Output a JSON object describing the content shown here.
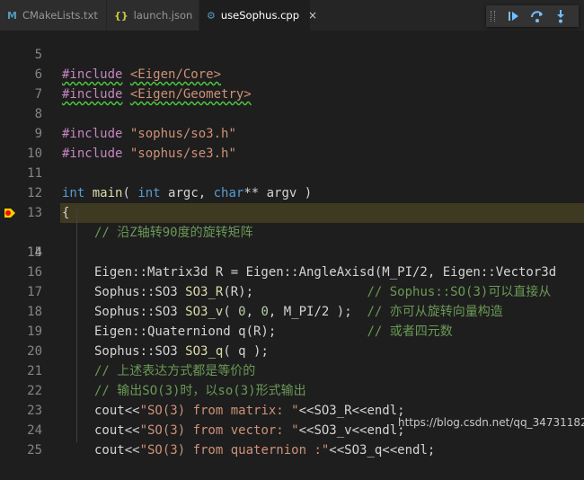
{
  "tabs": [
    {
      "icon": "M",
      "label": "CMakeLists.txt",
      "icon_color": "#519aba"
    },
    {
      "icon": "{}",
      "label": "launch.json",
      "icon_color": "#cbcb41"
    },
    {
      "icon": "⚙",
      "label": "useSophus.cpp",
      "icon_color": "#519aba",
      "active": true,
      "close": "×"
    }
  ],
  "debug_toolbar": {
    "buttons": [
      "continue-icon",
      "step-over-icon",
      "step-into-icon"
    ]
  },
  "editor": {
    "current_line": "14",
    "lines": [
      {
        "n": "5"
      },
      {
        "n": "6"
      },
      {
        "n": "7"
      },
      {
        "n": "8"
      },
      {
        "n": "9"
      },
      {
        "n": "10"
      },
      {
        "n": "11"
      },
      {
        "n": "12"
      },
      {
        "n": "13"
      },
      {
        "n": "14"
      },
      {
        "n": "15"
      },
      {
        "n": "16"
      },
      {
        "n": "17"
      },
      {
        "n": "18"
      },
      {
        "n": "19"
      },
      {
        "n": "20"
      },
      {
        "n": "21"
      },
      {
        "n": "22"
      },
      {
        "n": "23"
      },
      {
        "n": "24"
      },
      {
        "n": "25"
      }
    ],
    "t": {
      "inc": "#include",
      "l5": "<Eigen/Core>",
      "l6": "<Eigen/Geometry>",
      "l8": "\"sophus/so3.h\"",
      "l9": "\"sophus/se3.h\"",
      "int": "int",
      "main": "main",
      "char": "char",
      "l11a": "( ",
      "l11b": " argc, ",
      "l11c": "** argv )",
      "l12": "{",
      "l13": "// 沿Z轴转90度的旋转矩阵",
      "l14a": "Eigen::Matrix3d R = Eigen::AngleAxisd(M_PI/2, Eigen::Vector3d",
      "so3": "Sophus::SO3 ",
      "so3r": "SO3_R",
      "l16b": "(R);               ",
      "l16c": "// Sophus::SO(3)可以直接从",
      "so3v": "SO3_v",
      "l17b": "( ",
      "zero": "0",
      "comma": ", ",
      "l17c": "M_PI/2 );  ",
      "l17d": "// 亦可从旋转向量构造",
      "l18a": "Eigen::Quaterniond q(R);            ",
      "l18b": "// 或者四元数",
      "so3q": "SO3_q",
      "l19b": "( q );",
      "l20": "// 上述表达方式都是等价的",
      "l21": "// 输出SO(3)时，以so(3)形式输出",
      "cout": "cout<<",
      "l22s": "\"SO(3) from matrix: \"",
      "l22e": "<<SO3_R<<endl;",
      "l23s": "\"SO(3) from vector: \"",
      "l23e": "<<SO3_v<<endl;",
      "l24s": "\"SO(3) from quaternion :\"",
      "l24e": "<<SO3_q<<endl;"
    }
  },
  "watermark": "https://blog.csdn.net/qq_34731182"
}
